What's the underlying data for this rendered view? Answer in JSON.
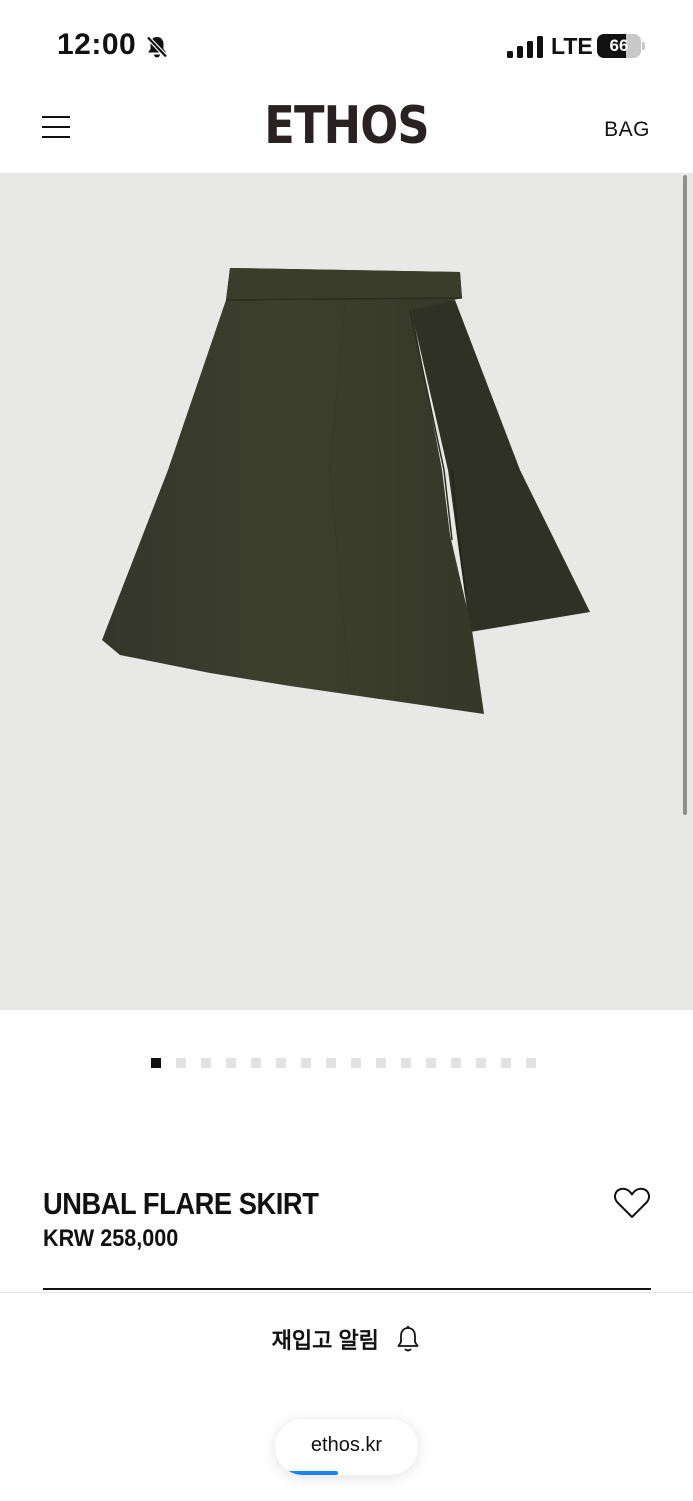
{
  "status_bar": {
    "time": "12:00",
    "network": "LTE",
    "battery_level": "66",
    "battery_fraction": 0.66,
    "icons": [
      "bell-slash-icon",
      "signal-bars-icon",
      "battery-icon"
    ]
  },
  "header": {
    "logo": "ETHOS",
    "bag_label": "BAG",
    "menu_icon": "hamburger-menu-icon"
  },
  "gallery": {
    "total_images": 16,
    "active_index": 0,
    "background_color": "#e8e8e6",
    "product_color": "#3b3d2c"
  },
  "product": {
    "name": "UNBAL FLARE SKIRT",
    "price": "KRW 258,000",
    "wishlist_icon": "heart-outline-icon"
  },
  "restock": {
    "label": "재입고 알림",
    "icon": "bell-icon"
  },
  "browser": {
    "url": "ethos.kr",
    "load_progress": 0.36,
    "accent_color": "#1a84ff"
  }
}
